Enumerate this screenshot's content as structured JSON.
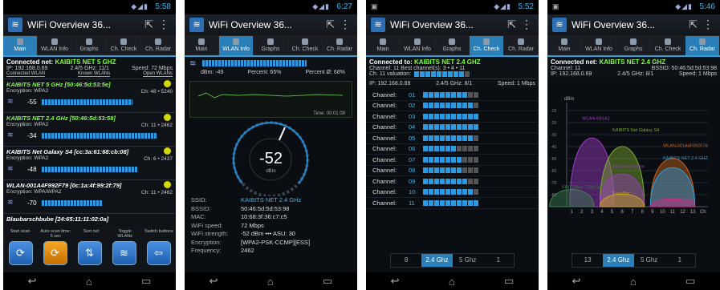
{
  "common": {
    "app_title": "WiFi Overview 36...",
    "tabs": [
      "Main",
      "WLAN Info",
      "Graphs",
      "Ch. Check",
      "Ch. Radar"
    ]
  },
  "p1": {
    "time": "5:58",
    "connected_label": "Connected net: ",
    "connected_ssid": "KAIBITS NET 5 GHZ",
    "ip": "IP: 192.168.0.69",
    "band": "2.4/5 GHz: 11/1",
    "speed": "Speed: 72 Mbps",
    "stats": [
      "Connected WLAN",
      "Known WLANs",
      "Open WLANs"
    ],
    "networks": [
      {
        "name": "KAIBITS NET 5 GHz [50:46:5d:53:5e]",
        "enc": "Encryption: WPA2",
        "ch": "Ch: 48 • 5240",
        "sig": "-55",
        "fill": 0.75
      },
      {
        "name": "KAIBITS NET 2.4 GHz [50:46:5d:53:58]",
        "enc": "Encryption: WPA2",
        "ch": "Ch: 11 • 2462",
        "sig": "-34",
        "fill": 0.95
      },
      {
        "name": "KAIBITS Net Galaxy S4 [cc:3a:61:68:cb:08]",
        "enc": "Encryption: WPA2",
        "ch": "Ch: 6 • 2437",
        "sig": "-48",
        "fill": 0.8
      },
      {
        "name": "WLAN-001A4F992F79 [0c:1a:4f:99:2f:79]",
        "enc": "Encryption: WPA/WPA2",
        "ch": "Ch: 11 • 2462",
        "sig": "-70",
        "fill": 0.5
      },
      {
        "name": "Blaubarschbube [24:65:11:11:02:0a]",
        "enc": "",
        "ch": "",
        "sig": "",
        "fill": 0
      }
    ],
    "btn_labels": [
      "Start scan",
      "Auto scan time: 5 sec",
      "Sort net",
      "Toggle WLANs",
      "Switch buttons"
    ]
  },
  "p2": {
    "time": "6:27",
    "dbm_label": "dBm: -49",
    "percent_label": "Percent: 65%",
    "percent_avg": "Percent Ø: 68%",
    "time_label": "Time: 00:01:09",
    "gauge_value": "-52",
    "gauge_unit": "dBm",
    "rows": [
      {
        "k": "SSID:",
        "v": "KAIBITS NET 2.4 GHz"
      },
      {
        "k": "BSSID:",
        "v": "50:46:5d:5d:53:98"
      },
      {
        "k": "MAC:",
        "v": "10:68:3f:36:c7:c5"
      },
      {
        "k": "WiFi speed:",
        "v": "72 Mbps"
      },
      {
        "k": "WiFi strength:",
        "v": "-52 dBm ••• ASU: 30"
      },
      {
        "k": "Encryption:",
        "v": "[WPA2-PSK-CCMP][ESS]"
      },
      {
        "k": "Frequency:",
        "v": "2462"
      }
    ]
  },
  "p3": {
    "time": "5:52",
    "connected_label": "Connected to: ",
    "connected_ssid": "KAIBITS NET 2.4 GHZ",
    "channel_line": "Channel: 11   Best channel(s): 3 • 4 • 11",
    "valuation": "Ch. 11 valuation:",
    "ip": "IP: 192.168.0.69",
    "band": "2.4/5 GHz: 8/1",
    "speed": "Speed: 1 Mbps",
    "channels": [
      {
        "label": "Channel:",
        "num": "01",
        "on": 8
      },
      {
        "label": "Channel:",
        "num": "02",
        "on": 9
      },
      {
        "label": "Channel:",
        "num": "03",
        "on": 10
      },
      {
        "label": "Channel:",
        "num": "04",
        "on": 10
      },
      {
        "label": "Channel:",
        "num": "05",
        "on": 9
      },
      {
        "label": "Channel:",
        "num": "06",
        "on": 6
      },
      {
        "label": "Channel:",
        "num": "07",
        "on": 7
      },
      {
        "label": "Channel:",
        "num": "08",
        "on": 7
      },
      {
        "label": "Channel:",
        "num": "09",
        "on": 8
      },
      {
        "label": "Channel:",
        "num": "10",
        "on": 9
      },
      {
        "label": "Channel:",
        "num": "11",
        "on": 10
      }
    ],
    "bottom_tabs": [
      "8",
      "2.4 Ghz",
      "5 Ghz",
      "1"
    ]
  },
  "p4": {
    "time": "5:46",
    "connected_label": "Connected net: ",
    "connected_ssid": "KAIBITS NET 2.4 GHZ",
    "channel": "Channel: 11",
    "bssid": "BSSID: 50:46:5d:5d:53:98",
    "ip": "IP: 192.168.0.69",
    "band": "2.4/5 GHz: 8/1",
    "speed": "Speed: 1 Mbps",
    "ylabel": "dBm",
    "ticks": [
      "-10",
      "-20",
      "-30",
      "-40",
      "-50",
      "-60",
      "-70",
      "-80"
    ],
    "xticks": [
      "1",
      "2",
      "3",
      "4",
      "5",
      "6",
      "7",
      "8",
      "9",
      "10",
      "11",
      "12",
      "13",
      "Ch"
    ],
    "curve_labels": [
      "WLAN-6B1A1",
      "KAIBITS Net Galaxy S4",
      "WLAN-001A4F992F79",
      "KAIBITS NET 2.4 GHZ",
      "Blaubarschbube",
      "FRITZ!Box 7330 SL",
      "EasyBox",
      "WLAN-B5F2B8"
    ],
    "bottom_tabs": [
      "13",
      "2.4 Ghz",
      "5 Ghz",
      "1"
    ]
  }
}
